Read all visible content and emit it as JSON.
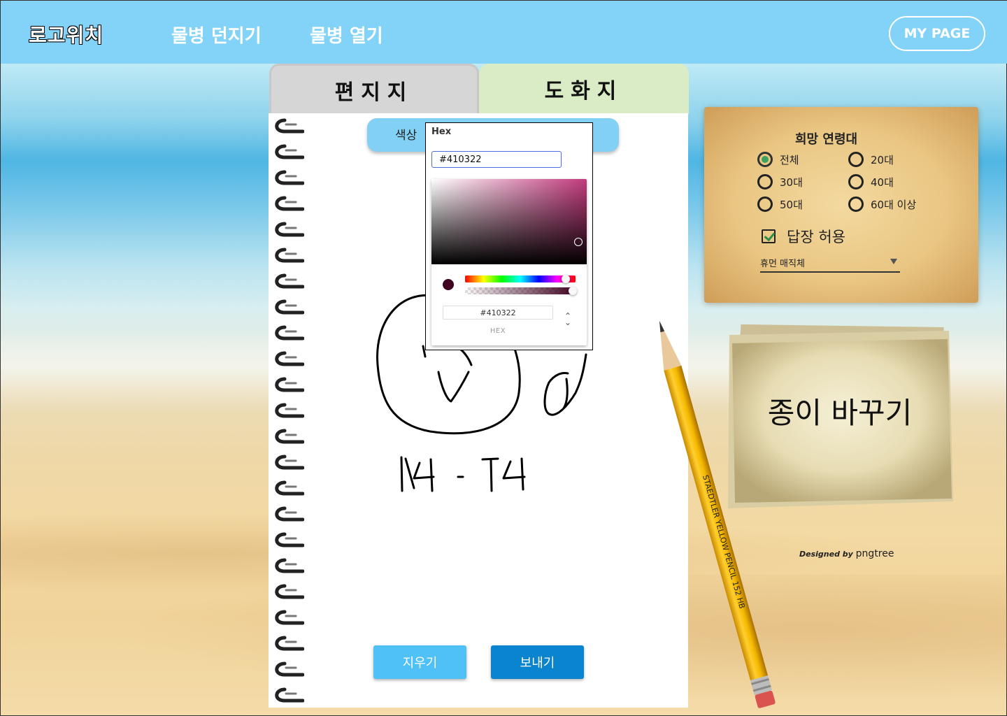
{
  "header": {
    "logo": "로고위치",
    "nav": [
      "물병 던지기",
      "물병 열기"
    ],
    "mypage": "MY PAGE"
  },
  "tabs": [
    {
      "label": "편지지",
      "active": false
    },
    {
      "label": "도화지",
      "active": true
    }
  ],
  "toolbar": {
    "color_label": "색상"
  },
  "color_picker": {
    "title": "Hex",
    "hex_input": "#410322",
    "hex_value": "#410322",
    "hex_caption": "HEX",
    "current_color": "#410322",
    "hue_color": "#c23b7d"
  },
  "canvas": {
    "drawn_text": "1\\4 - T4"
  },
  "buttons": {
    "clear": "지우기",
    "send": "보내기"
  },
  "pencil": {
    "imprint": "STAEDTLER YELLOW PENCIL 152 HB"
  },
  "options": {
    "age_title": "희망 연령대",
    "ages": [
      {
        "label": "전체",
        "checked": true
      },
      {
        "label": "20대",
        "checked": false
      },
      {
        "label": "30대",
        "checked": false
      },
      {
        "label": "40대",
        "checked": false
      },
      {
        "label": "50대",
        "checked": false
      },
      {
        "label": "60대 이상",
        "checked": false
      }
    ],
    "allow_reply_label": "답장 허용",
    "allow_reply": true,
    "font_select": "휴먼 매직체"
  },
  "change_paper": {
    "label": "종이 바꾸기"
  },
  "credit": {
    "prefix": "Designed by",
    "brand": "pngtree"
  }
}
